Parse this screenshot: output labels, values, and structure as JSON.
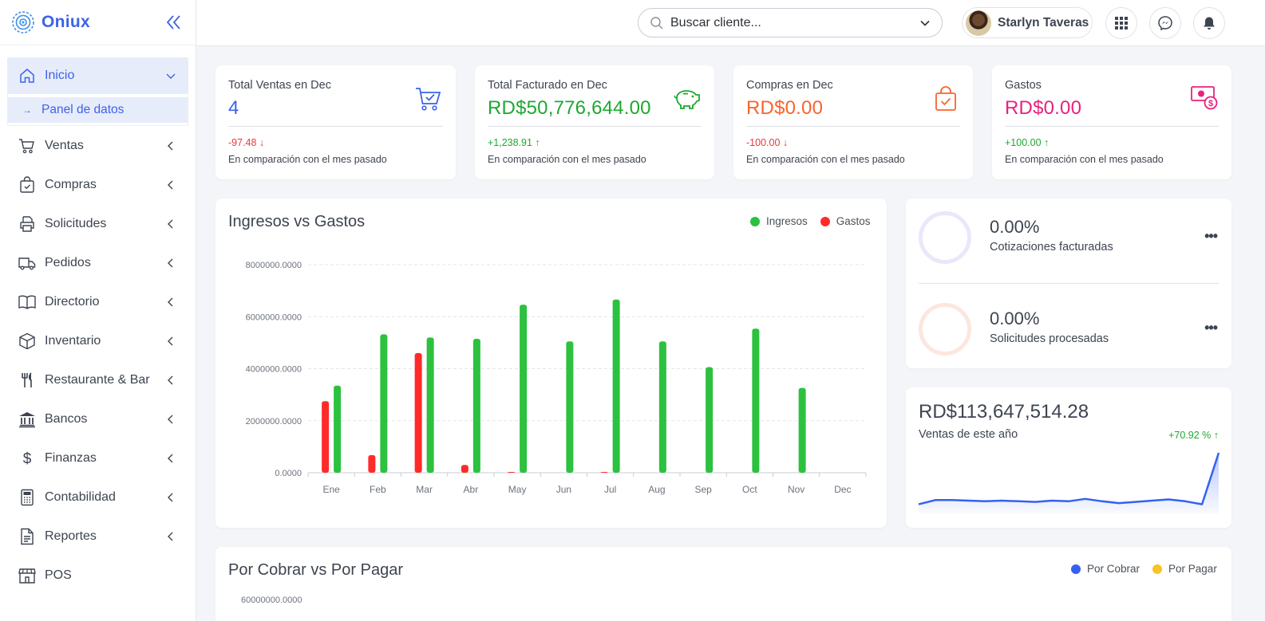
{
  "brand": {
    "name": "Oniux"
  },
  "sidebar": {
    "active": {
      "label": "Inicio",
      "sub": "Panel de datos"
    },
    "items": [
      {
        "label": "Ventas",
        "icon": "cart-icon"
      },
      {
        "label": "Compras",
        "icon": "shopping-bag-icon"
      },
      {
        "label": "Solicitudes",
        "icon": "printer-icon"
      },
      {
        "label": "Pedidos",
        "icon": "truck-icon"
      },
      {
        "label": "Directorio",
        "icon": "book-icon"
      },
      {
        "label": "Inventario",
        "icon": "box-icon"
      },
      {
        "label": "Restaurante & Bar",
        "icon": "utensils-icon"
      },
      {
        "label": "Bancos",
        "icon": "bank-icon"
      },
      {
        "label": "Finanzas",
        "icon": "dollar-icon"
      },
      {
        "label": "Contabilidad",
        "icon": "calculator-icon"
      },
      {
        "label": "Reportes",
        "icon": "report-icon"
      },
      {
        "label": "POS",
        "icon": "store-icon"
      }
    ]
  },
  "topbar": {
    "search_value": "Buscar cliente...",
    "user_name": "Starlyn Taveras"
  },
  "stats": [
    {
      "title": "Total Ventas en Dec",
      "value": "4",
      "value_color": "#3d63e6",
      "delta": "-97.48 ↓",
      "delta_color": "#e8383d",
      "compare": "En comparación con el mes pasado",
      "icon": "cart-check-icon"
    },
    {
      "title": "Total Facturado en Dec",
      "value": "RD$50,776,644.00",
      "value_color": "#1ea831",
      "delta": "+1,238.91 ↑",
      "delta_color": "#1ea831",
      "compare": "En comparación con el mes pasado",
      "icon": "piggy-bank-icon"
    },
    {
      "title": "Compras en Dec",
      "value": "RD$0.00",
      "value_color": "#f7652b",
      "delta": "-100.00 ↓",
      "delta_color": "#e8383d",
      "compare": "En comparación con el mes pasado",
      "icon": "shopping-bag-check-icon"
    },
    {
      "title": "Gastos",
      "value": "RD$0.00",
      "value_color": "#e8227d",
      "delta": "+100.00 ↑",
      "delta_color": "#1ea831",
      "compare": "En comparación con el mes pasado",
      "icon": "money-bill-icon"
    }
  ],
  "income_chart": {
    "title": "Ingresos vs Gastos",
    "legend_income": "Ingresos",
    "legend_expense": "Gastos",
    "colors": {
      "income": "#2cc13f",
      "expense": "#ff2a2a"
    }
  },
  "chart_data": {
    "type": "bar",
    "title": "Ingresos vs Gastos",
    "categories": [
      "Ene",
      "Feb",
      "Mar",
      "Abr",
      "May",
      "Jun",
      "Jul",
      "Aug",
      "Sep",
      "Oct",
      "Nov",
      "Dec"
    ],
    "y_ticks": [
      "8000000.0000",
      "6000000.0000",
      "4000000.0000",
      "2000000.0000",
      "0.0000"
    ],
    "ylim": [
      0,
      8000000
    ],
    "series": [
      {
        "name": "Gastos",
        "values": [
          2750000,
          680000,
          4600000,
          300000,
          30000,
          0,
          30000,
          0,
          0,
          0,
          0,
          0
        ]
      },
      {
        "name": "Ingresos",
        "values": [
          3350000,
          5320000,
          5200000,
          5150000,
          6460000,
          5050000,
          6660000,
          5050000,
          4060000,
          5540000,
          3260000,
          0
        ]
      }
    ]
  },
  "kpis": [
    {
      "value": "0.00%",
      "label": "Cotizaciones facturadas",
      "ring_color": "#ece6fb"
    },
    {
      "value": "0.00%",
      "label": "Solicitudes procesadas",
      "ring_color": "#fde6df"
    }
  ],
  "yearly": {
    "value": "RD$113,647,514.28",
    "label": "Ventas de este año",
    "delta": "+70.92 % ↑",
    "sparkline": [
      0.15,
      0.22,
      0.22,
      0.21,
      0.2,
      0.21,
      0.2,
      0.19,
      0.21,
      0.2,
      0.24,
      0.2,
      0.17,
      0.19,
      0.21,
      0.23,
      0.2,
      0.15,
      1.0
    ]
  },
  "receivables": {
    "title": "Por Cobrar vs Por Pagar",
    "legend_receivable": "Por Cobrar",
    "legend_payable": "Por Pagar",
    "top_tick": "60000000.0000",
    "colors": {
      "receivable": "#3561f2",
      "payable": "#f7c325"
    }
  }
}
